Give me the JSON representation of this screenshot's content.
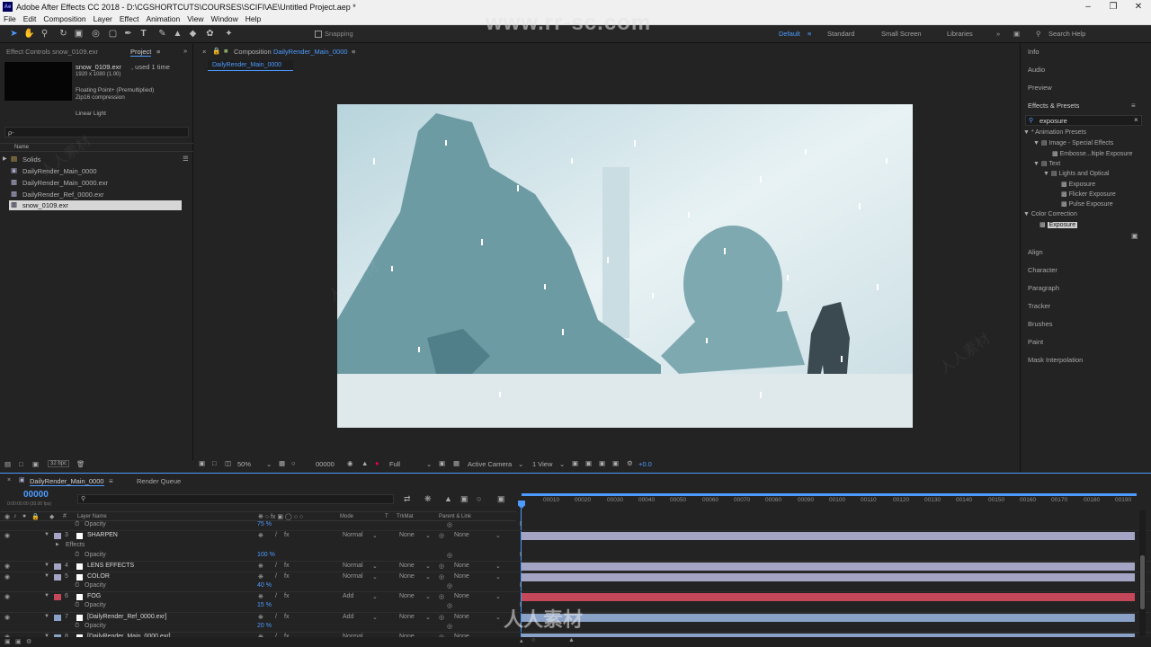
{
  "window": {
    "title": "Adobe After Effects CC 2018 - D:\\CGSHORTCUTS\\COURSES\\SCIFI\\AE\\Untitled Project.aep *"
  },
  "menu": [
    "File",
    "Edit",
    "Composition",
    "Layer",
    "Effect",
    "Animation",
    "View",
    "Window",
    "Help"
  ],
  "toolbar": {
    "snapping": "Snapping",
    "workspaces": [
      "Default",
      "Standard",
      "Small Screen",
      "Libraries"
    ],
    "search_placeholder": "Search Help"
  },
  "watermark": {
    "url": "www.rr-sc.com",
    "brand": "人人素材"
  },
  "project": {
    "tab_effect_controls": "Effect Controls snow_0109.exr",
    "tab_project": "Project",
    "preview_name": "snow_0109.exr",
    "preview_used": ", used 1 time",
    "preview_dims": "1920 x 1080 (1.00)",
    "preview_float": "Floating Point+ (Premultiplied)",
    "preview_comp": "Zip16 compression",
    "preview_light": "Linear Light",
    "search_placeholder": "ρ-",
    "col_name": "Name",
    "items": [
      "Solids",
      "DailyRender_Main_0000",
      "DailyRender_Main_0000.exr",
      "DailyRender_Ref_0000.exr",
      "snow_0109.exr"
    ],
    "bpc": "32 bpc"
  },
  "composition": {
    "tab": "Composition",
    "comp_name": "DailyRender_Main_0000",
    "crumb": "DailyRender_Main_0000",
    "zoom": "50%",
    "timecode": "00000",
    "resolution": "Full",
    "camera": "Active Camera",
    "views": "1 View",
    "exposure": "+0.0"
  },
  "right_panel": {
    "items_top": [
      "Info",
      "Audio",
      "Preview"
    ],
    "effects_title": "Effects & Presets",
    "search_value": "exposure",
    "tree": [
      "* Animation Presets",
      "Image - Special Effects",
      "Embosse...ltiple Exposure",
      "Text",
      "Lights and Optical",
      "Exposure",
      "Flicker Exposure",
      "Pulse Exposure",
      "Color Correction",
      "Exposure"
    ],
    "items_bottom": [
      "Align",
      "Character",
      "Paragraph",
      "Tracker",
      "Brushes",
      "Paint",
      "Mask Interpolation"
    ]
  },
  "timeline": {
    "tab": "DailyRender_Main_0000",
    "render_queue": "Render Queue",
    "timecode": "00000",
    "timecode_sub": "0:00:00:00 (30.00 fps)",
    "cols": {
      "layer_name": "Layer Name",
      "mode": "Mode",
      "t": "T",
      "trkmat": "TrkMat",
      "parent": "Parent & Link"
    },
    "ruler": [
      "00010",
      "00020",
      "00030",
      "00040",
      "00050",
      "00060",
      "00070",
      "00080",
      "00090",
      "00100",
      "00110",
      "00120",
      "00130",
      "00140",
      "00150",
      "00160",
      "00170",
      "00180",
      "00190"
    ],
    "rows": [
      {
        "type": "prop",
        "label": "Opacity",
        "value": "75 %"
      },
      {
        "type": "layer",
        "num": "3",
        "name": "SHARPEN",
        "mode": "Normal",
        "trkmat": "None",
        "parent": "None",
        "color": "#a4a4c4"
      },
      {
        "type": "group",
        "label": "Effects"
      },
      {
        "type": "prop",
        "label": "Opacity",
        "value": "100 %"
      },
      {
        "type": "layer",
        "num": "4",
        "name": "LENS EFFECTS",
        "mode": "Normal",
        "trkmat": "None",
        "parent": "None",
        "color": "#a4a4c4"
      },
      {
        "type": "layer",
        "num": "5",
        "name": "COLOR",
        "mode": "Normal",
        "trkmat": "None",
        "parent": "None",
        "color": "#a4a4c4"
      },
      {
        "type": "prop",
        "label": "Opacity",
        "value": "40 %"
      },
      {
        "type": "layer",
        "num": "6",
        "name": "FOG",
        "mode": "Add",
        "trkmat": "None",
        "parent": "None",
        "color": "#c4475a"
      },
      {
        "type": "prop",
        "label": "Opacity",
        "value": "15 %"
      },
      {
        "type": "layer",
        "num": "7",
        "name": "[DailyRender_Ref_0000.exr]",
        "mode": "Add",
        "trkmat": "None",
        "parent": "None",
        "color": "#8aa2c8"
      },
      {
        "type": "prop",
        "label": "Opacity",
        "value": "20 %"
      },
      {
        "type": "layer",
        "num": "8",
        "name": "[DailyRender_Main_0000.exr]",
        "mode": "Normal",
        "trkmat": "None",
        "parent": "None",
        "color": "#8aa2c8"
      }
    ]
  },
  "colors": {
    "accent": "#4d9bff",
    "panel": "#232323",
    "border": "#111111",
    "fog": "#c4475a",
    "layer_bar": "#a4a4c4",
    "footage_bar": "#8aa2c8"
  }
}
